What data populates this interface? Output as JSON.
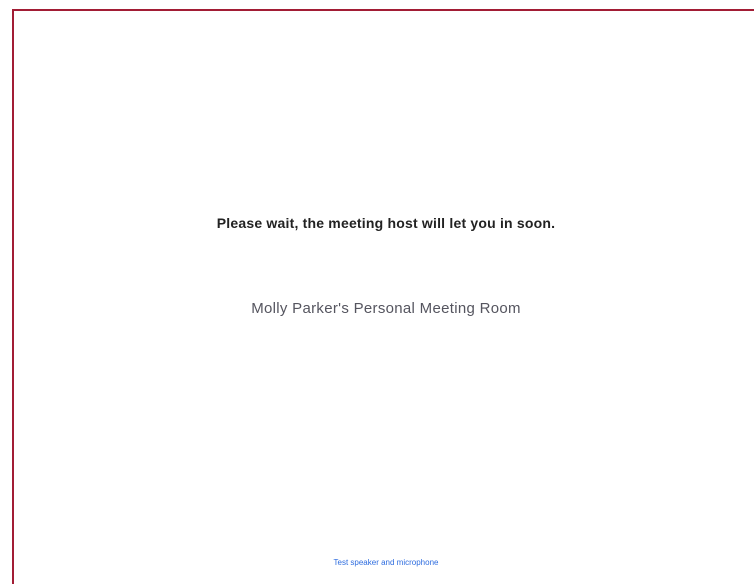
{
  "waiting_room": {
    "message": "Please wait, the meeting host will let you in soon.",
    "room_name": "Molly Parker's Personal Meeting Room",
    "audio_link": "Test speaker and microphone"
  },
  "colors": {
    "border": "#a21d35",
    "link": "#2d6cdf"
  }
}
